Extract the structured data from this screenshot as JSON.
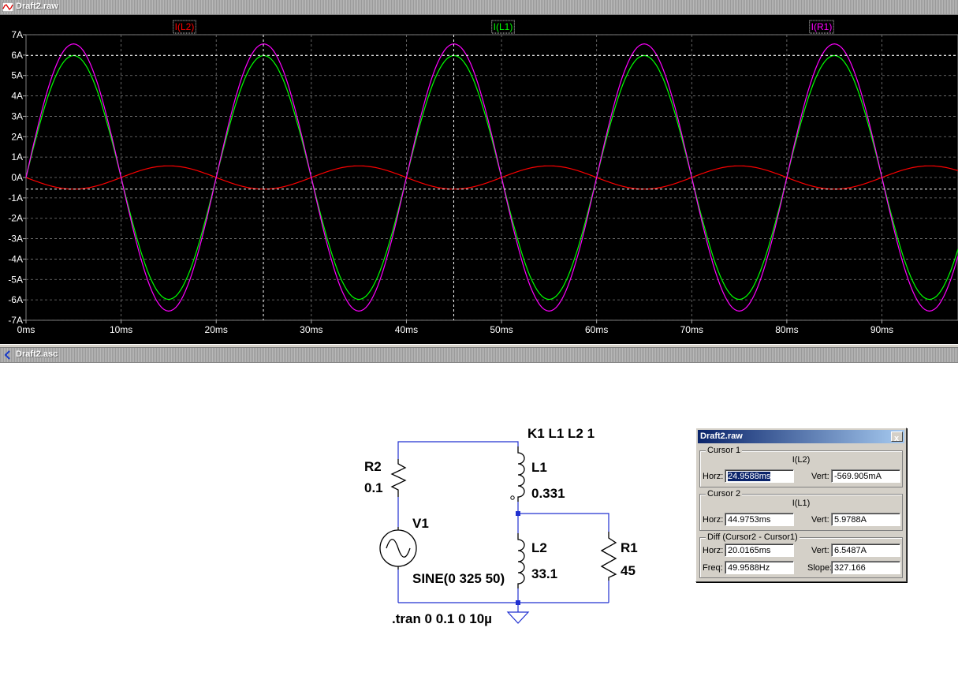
{
  "plot_window": {
    "title": "Draft2.raw"
  },
  "schematic_window": {
    "title": "Draft2.asc"
  },
  "chart_data": {
    "type": "line",
    "title": "",
    "xlabel": "",
    "ylabel": "",
    "xlim": [
      0,
      98
    ],
    "ylim": [
      -7,
      7
    ],
    "x_ticks": [
      "0ms",
      "10ms",
      "20ms",
      "30ms",
      "40ms",
      "50ms",
      "60ms",
      "70ms",
      "80ms",
      "90ms"
    ],
    "y_ticks": [
      "7A",
      "6A",
      "5A",
      "4A",
      "3A",
      "2A",
      "1A",
      "0A",
      "-1A",
      "-2A",
      "-3A",
      "-4A",
      "-5A",
      "-6A",
      "-7A"
    ],
    "grid": true,
    "background": "#000000",
    "series": [
      {
        "name": "I(L2)",
        "color": "#ff0000",
        "amplitude": 0.57,
        "frequency_hz": 50,
        "sign": -1
      },
      {
        "name": "I(L1)",
        "color": "#00ff00",
        "amplitude": 5.98,
        "frequency_hz": 50,
        "sign": 1
      },
      {
        "name": "I(R1)",
        "color": "#ff00ff",
        "amplitude": 6.55,
        "frequency_hz": 50,
        "sign": 1
      }
    ],
    "cursors": [
      {
        "x": 24.9588,
        "y": -0.5699
      },
      {
        "x": 44.9753,
        "y": 5.9788
      }
    ]
  },
  "schematic": {
    "directive_coupling": "K1 L1 L2 1",
    "directive_tran": ".tran 0 0.1 0 10µ",
    "R2": {
      "name": "R2",
      "value": "0.1"
    },
    "L1": {
      "name": "L1",
      "value": "0.331"
    },
    "L2": {
      "name": "L2",
      "value": "33.1"
    },
    "R1": {
      "name": "R1",
      "value": "45"
    },
    "V1": {
      "name": "V1",
      "value": "SINE(0 325 50)"
    }
  },
  "cursor_dialog": {
    "title": "Draft2.raw",
    "close_label": "x",
    "cursor1": {
      "label": "Cursor 1",
      "trace": "I(L2)",
      "horz_label": "Horz:",
      "horz": "24.9588ms",
      "vert_label": "Vert:",
      "vert": "-569.905mA"
    },
    "cursor2": {
      "label": "Cursor 2",
      "trace": "I(L1)",
      "horz_label": "Horz:",
      "horz": "44.9753ms",
      "vert_label": "Vert:",
      "vert": "5.9788A"
    },
    "diff": {
      "label": "Diff (Cursor2 - Cursor1)",
      "horz_label": "Horz:",
      "horz": "20.0165ms",
      "vert_label": "Vert:",
      "vert": "6.5487A",
      "freq_label": "Freq:",
      "freq": "49.9588Hz",
      "slope_label": "Slope:",
      "slope": "327.166"
    }
  }
}
